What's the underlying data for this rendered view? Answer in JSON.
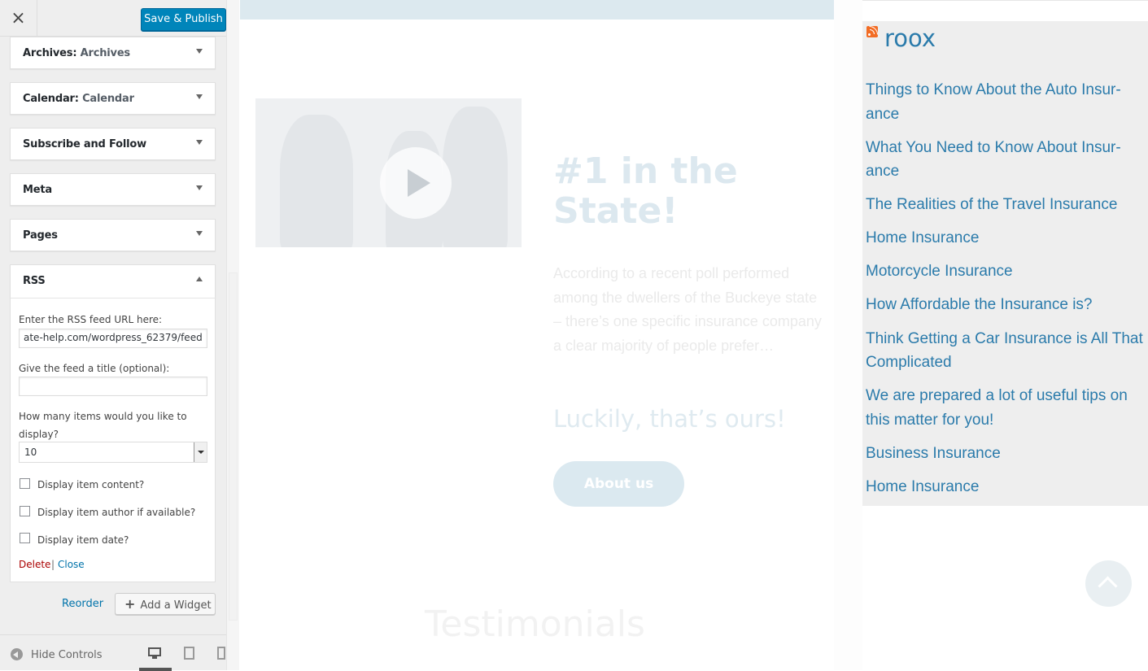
{
  "sidebar": {
    "close_label": "×",
    "save_label": "Save & Publish",
    "widgets": [
      {
        "name": "Archives",
        "sub": "Archives"
      },
      {
        "name": "Calendar",
        "sub": "Calendar"
      },
      {
        "name": "Subscribe and Follow",
        "sub": ""
      },
      {
        "name": "Meta",
        "sub": ""
      },
      {
        "name": "Pages",
        "sub": ""
      },
      {
        "name": "RSS",
        "sub": ""
      }
    ],
    "rss_form": {
      "url_label": "Enter the RSS feed URL here:",
      "url_value": "ate-help.com/wordpress_62379/feed",
      "title_label": "Give the feed a title (optional):",
      "title_value": "",
      "count_label_1": "How many items would you like to",
      "count_label_2": "display?",
      "count_value": "10",
      "opt_content": "Display item content?",
      "opt_author": "Display item author if available?",
      "opt_date": "Display item date?",
      "delete_label": "Delete",
      "separator": "|",
      "close_label": "Close"
    },
    "reorder_label": "Reorder",
    "add_widget_label": "Add a Widget",
    "footer": {
      "hide_controls_label": "Hide Controls"
    }
  },
  "preview": {
    "hero_heading": "#1 in the State!",
    "hero_text": "According to a recent poll performed among the dwellers of the Buckeye state – there’s one specific insurance company a clear majority of people prefer…",
    "hero_sub": "Luckily, that’s ours!",
    "about_label": "About us",
    "testimonials_label": "Testimonials",
    "rss_widget": {
      "title": "roox",
      "items": [
        "Things to Know About the Auto Insur-ance",
        "What You Need to Know About Insur-ance",
        "The Realities of the Travel Insurance",
        "Home Insurance",
        "Motorcycle Insurance",
        "How Affordable the Insurance is?",
        "Think Getting a Car Insurance is All That Complicated",
        "We are prepared a lot of useful tips on this matter for you!",
        "Business Insurance",
        "Home Insurance"
      ]
    }
  },
  "colors": {
    "primary_button": "#0085ba",
    "link": "#0073aa",
    "delete_link": "#aa0000",
    "rss_link": "#2b7bab"
  },
  "icons": [
    "close-icon",
    "chevron-down-icon",
    "chevron-up-icon",
    "plus-icon",
    "hide-controls-icon",
    "desktop-icon",
    "tablet-icon",
    "mobile-icon",
    "play-icon",
    "rss-feed-icon",
    "scroll-top-icon"
  ]
}
